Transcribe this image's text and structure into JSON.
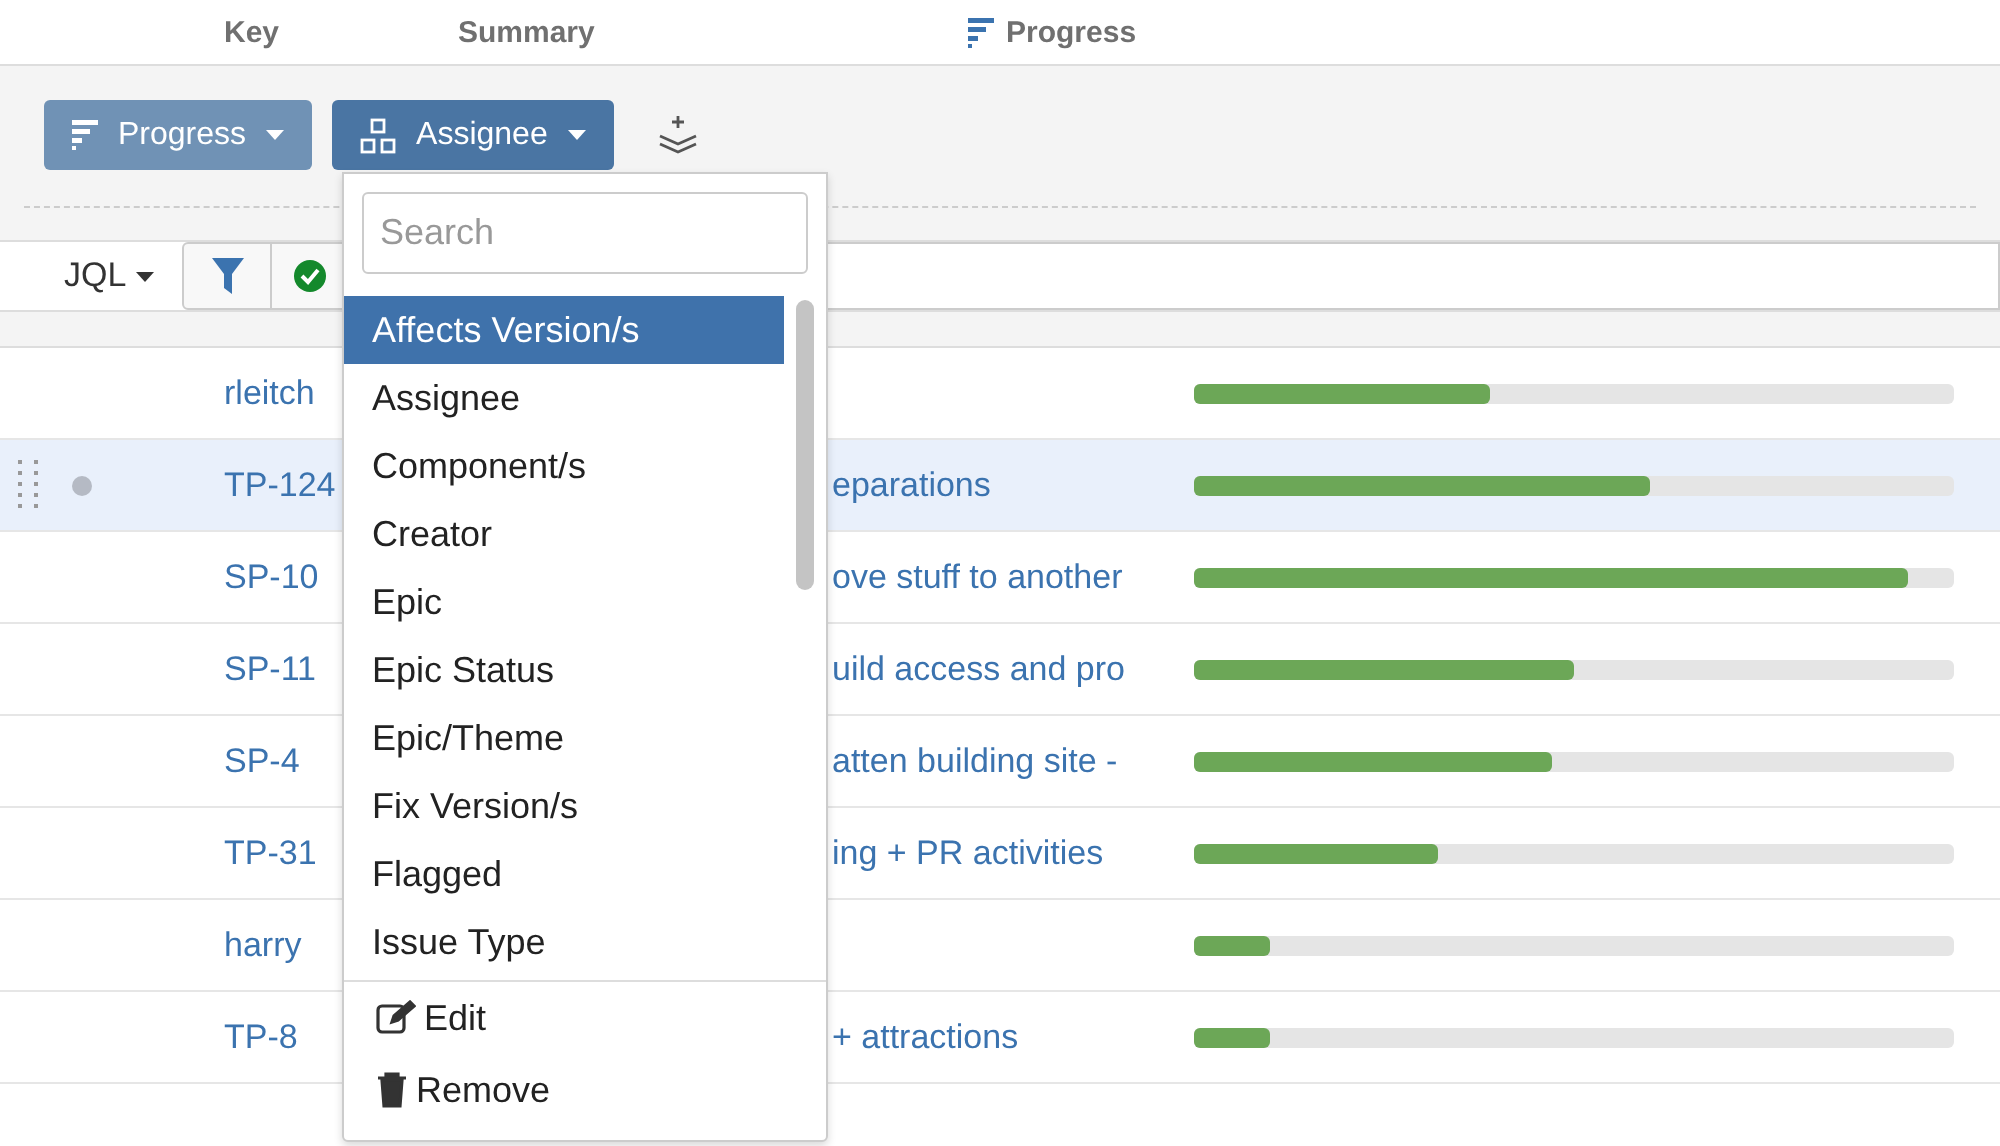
{
  "columns": [
    {
      "label": "Key",
      "kind": "plain"
    },
    {
      "label": "Summary",
      "kind": "plain"
    },
    {
      "label": "Progress",
      "kind": "progress"
    }
  ],
  "toolbar": {
    "buttons": [
      {
        "label": "Progress",
        "kind": "progress",
        "selected": false
      },
      {
        "label": "Assignee",
        "kind": "group",
        "selected": true
      }
    ]
  },
  "query": {
    "mode": "JQL"
  },
  "rows": [
    {
      "key": "rleitch",
      "summary": "",
      "level": 0.39,
      "selected": false
    },
    {
      "key": "TP-124",
      "summary": "eparations",
      "level": 0.6,
      "selected": true
    },
    {
      "key": "SP-10",
      "summary": "ove stuff to another",
      "level": 0.94,
      "selected": false
    },
    {
      "key": "SP-11",
      "summary": "uild access and pro",
      "level": 0.5,
      "selected": false
    },
    {
      "key": "SP-4",
      "summary": "atten building site -",
      "level": 0.47,
      "selected": false
    },
    {
      "key": "TP-31",
      "summary": "ing + PR activities",
      "level": 0.32,
      "selected": false
    },
    {
      "key": "harry",
      "summary": "",
      "level": 0.1,
      "selected": false
    },
    {
      "key": "TP-8",
      "summary": "+ attractions",
      "level": 0.1,
      "selected": false
    }
  ],
  "dropdown": {
    "search": {
      "placeholder": "Search"
    },
    "items": [
      {
        "label": "Affects Version/s",
        "selected": true
      },
      {
        "label": "Assignee",
        "selected": false
      },
      {
        "label": "Component/s",
        "selected": false
      },
      {
        "label": "Creator",
        "selected": false
      },
      {
        "label": "Epic",
        "selected": false
      },
      {
        "label": "Epic Status",
        "selected": false
      },
      {
        "label": "Epic/Theme",
        "selected": false
      },
      {
        "label": "Fix Version/s",
        "selected": false
      },
      {
        "label": "Flagged",
        "selected": false
      },
      {
        "label": "Issue Type",
        "selected": false
      }
    ],
    "actions": [
      {
        "label": "Edit",
        "kind": "edit"
      },
      {
        "label": "Remove",
        "kind": "remove"
      }
    ]
  }
}
